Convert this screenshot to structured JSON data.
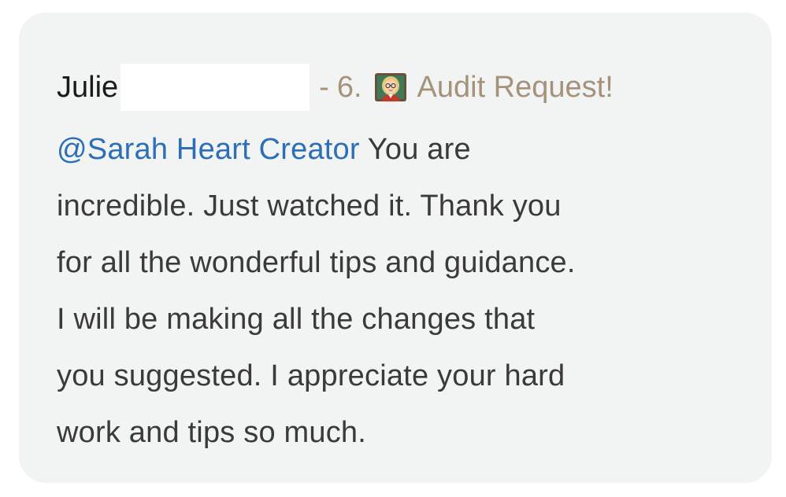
{
  "message": {
    "author": "Julie",
    "separator": "-",
    "channel": {
      "number": "6.",
      "icon": "teacher-emoji-icon",
      "name": "Audit Request!"
    },
    "mention": "@Sarah Heart Creator",
    "lines": [
      " You are",
      "incredible. Just watched it. Thank you",
      "for all the wonderful tips and guidance.",
      "I will be making all the changes that",
      "you suggested. I appreciate your hard",
      "work and tips so much."
    ]
  },
  "colors": {
    "card_background": "#f1f4f3",
    "mention": "#2d6fb7",
    "channel": "#a4927a",
    "text": "#3a3a3a"
  }
}
